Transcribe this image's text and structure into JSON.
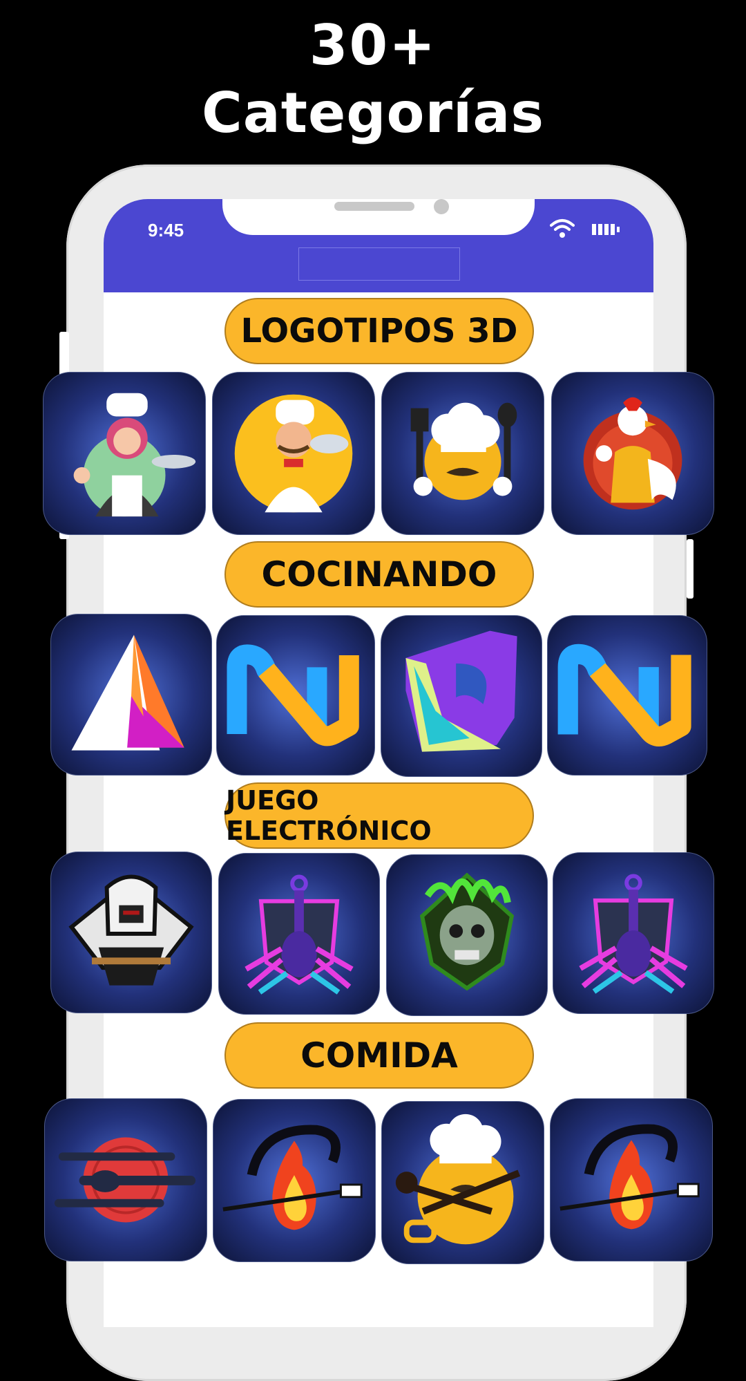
{
  "headline": {
    "line1": "30+",
    "line2": "Categorías"
  },
  "status_bar": {
    "time": "9:45"
  },
  "categories": [
    {
      "label": "LOGOTIPOS 3D",
      "items": [
        "chef-woman-logo",
        "chef-man-plate-logo",
        "chef-hat-mustache-logo",
        "rooster-mascot-logo"
      ]
    },
    {
      "label": "COCINANDO",
      "items": [
        "letter-a-3d-logo",
        "letter-n-3d-logo",
        "letter-b-3d-logo",
        "letter-n-3d-logo"
      ]
    },
    {
      "label": "JUEGO ELECTRÓNICO",
      "items": [
        "ninja-esports-logo",
        "scorpion-esports-logo",
        "green-skull-esports-logo",
        "scorpion-esports-logo"
      ]
    },
    {
      "label": "COMIDA",
      "items": [
        "plate-fork-spoon-logo",
        "flame-spatula-logo",
        "chef-pot-logo",
        "flame-spatula-logo"
      ]
    }
  ],
  "colors": {
    "accent": "#fbb62a",
    "status_bar": "#4b47d1",
    "tile_bg": "#22317a"
  }
}
